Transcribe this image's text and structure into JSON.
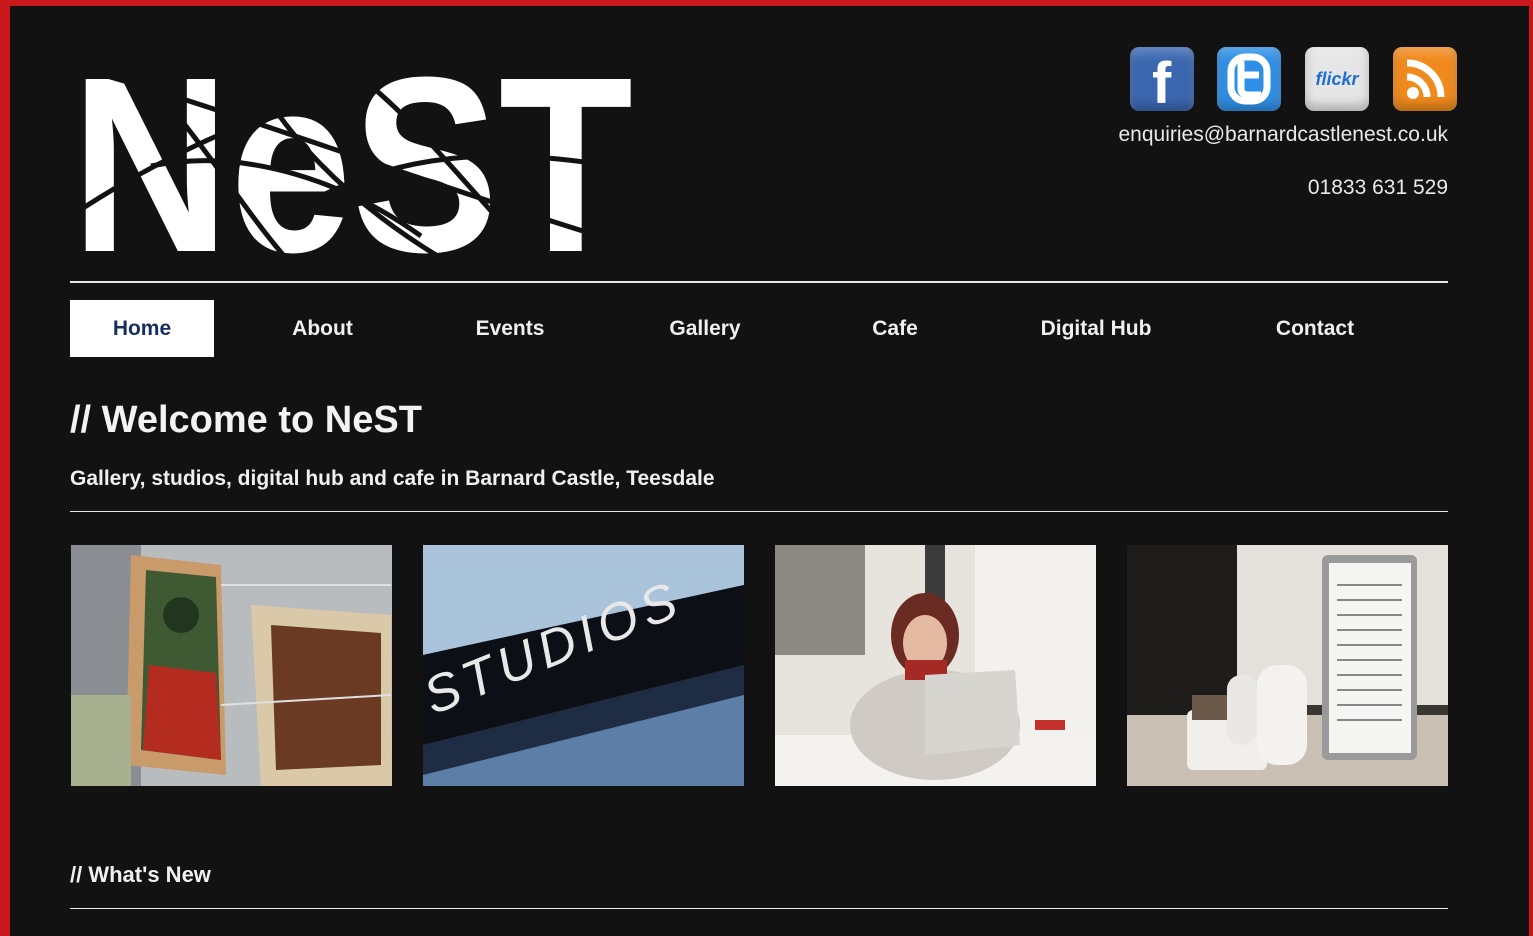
{
  "logo": {
    "text": "NeST"
  },
  "social": [
    {
      "name": "facebook-icon",
      "glyph": "f",
      "color": "#3b67b1"
    },
    {
      "name": "twitter-icon",
      "glyph": "t",
      "color": "#2f8fe6"
    },
    {
      "name": "flickr-icon",
      "glyph": "flickr",
      "color": "#e6e6e6"
    },
    {
      "name": "rss-icon",
      "glyph": "",
      "color": "#f08a1c"
    }
  ],
  "contact": {
    "email": "enquiries@barnardcastlenest.co.uk",
    "phone": "01833 631 529"
  },
  "nav": {
    "items": [
      {
        "label": "Home",
        "active": true
      },
      {
        "label": "About"
      },
      {
        "label": "Events"
      },
      {
        "label": "Gallery"
      },
      {
        "label": "Cafe"
      },
      {
        "label": "Digital Hub"
      },
      {
        "label": "Contact"
      }
    ]
  },
  "main": {
    "heading": "// Welcome to NeST",
    "tagline": "Gallery, studios, digital hub and cafe in Barnard Castle, Teesdale",
    "photos": [
      {
        "name": "postcards-photo"
      },
      {
        "name": "studios-sign-photo",
        "sign_text": "STUDIOS"
      },
      {
        "name": "woman-laptop-photo"
      },
      {
        "name": "cafe-table-photo"
      }
    ],
    "whats_new": "// What's New"
  }
}
